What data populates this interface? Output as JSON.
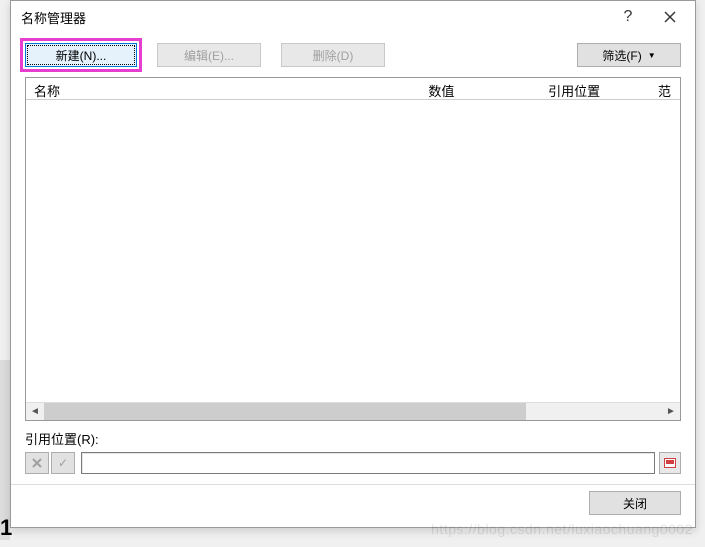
{
  "dialog": {
    "title": "名称管理器",
    "help_symbol": "?"
  },
  "toolbar": {
    "new_label": "新建(N)...",
    "edit_label": "编辑(E)...",
    "delete_label": "删除(D)",
    "filter_label": "筛选(F)"
  },
  "columns": {
    "name": "名称",
    "value": "数值",
    "ref": "引用位置",
    "scope": "范围"
  },
  "reference": {
    "label": "引用位置(R):",
    "value": ""
  },
  "footer": {
    "close_label": "关闭"
  },
  "watermark": "https://blog.csdn.net/luxiaochuang0002",
  "bg_fragment_text": "1"
}
